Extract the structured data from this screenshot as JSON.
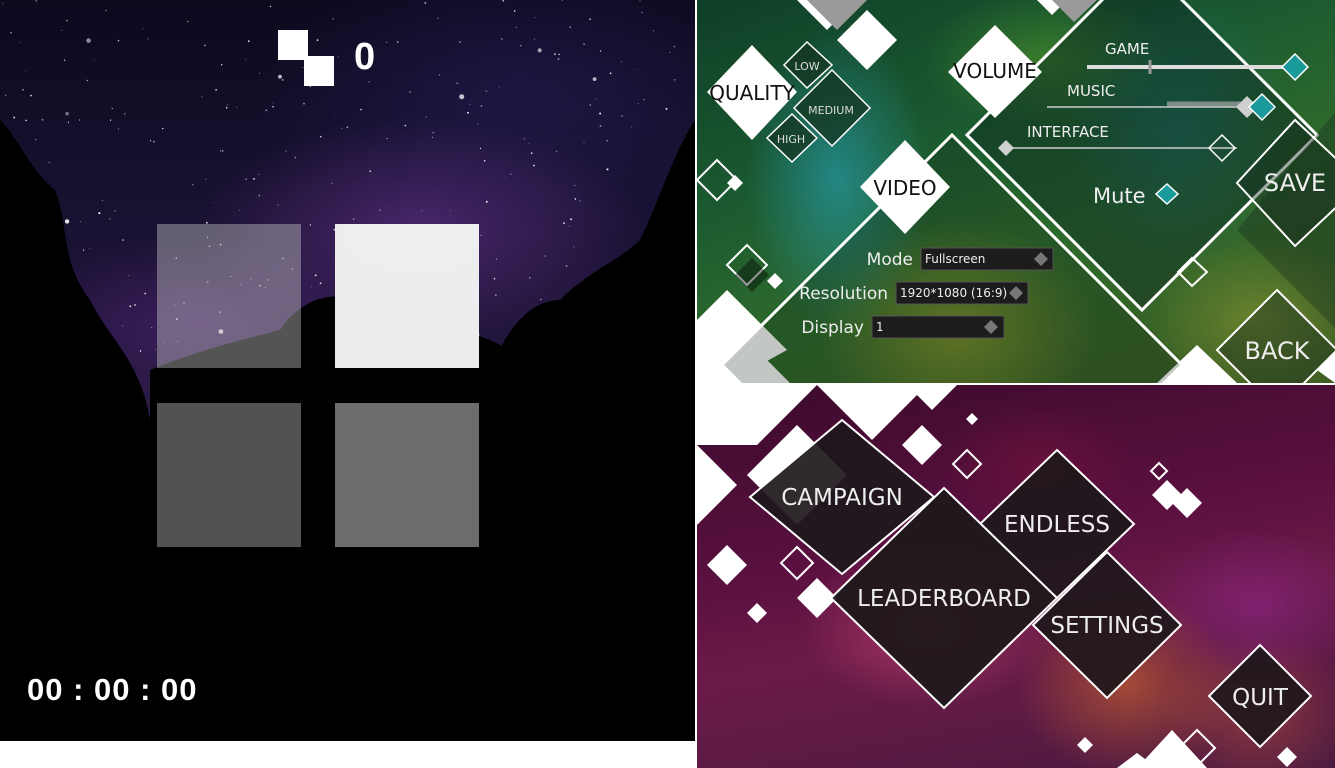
{
  "game": {
    "score": "0",
    "timer": "00 : 00 : 00",
    "tiles": [
      {
        "id": "tl",
        "state": "dim"
      },
      {
        "id": "tr",
        "state": "lit"
      },
      {
        "id": "bl",
        "state": "dim"
      },
      {
        "id": "br",
        "state": "dim"
      }
    ]
  },
  "settings": {
    "quality": {
      "label": "QUALITY",
      "options": [
        "LOW",
        "MEDIUM",
        "HIGH"
      ]
    },
    "volume": {
      "label": "VOLUME",
      "sliders": [
        {
          "label": "GAME",
          "value": 0.93
        },
        {
          "label": "MUSIC",
          "value": 0.92
        },
        {
          "label": "INTERFACE",
          "value": 0.0
        }
      ],
      "mute_label": "Mute"
    },
    "video": {
      "label": "VIDEO",
      "rows": [
        {
          "label": "Mode",
          "value": "Fullscreen"
        },
        {
          "label": "Resolution",
          "value": "1920*1080 (16:9)"
        },
        {
          "label": "Display",
          "value": "1"
        }
      ]
    },
    "save_label": "SAVE",
    "back_label": "BACK"
  },
  "main_menu": {
    "campaign": "CAMPAIGN",
    "endless": "ENDLESS",
    "leaderboard": "LEADERBOARD",
    "settings": "SETTINGS",
    "quit": "QUIT"
  },
  "colors": {
    "accent_teal": "#1a9a9a",
    "panel_dark": "#1e1a1c"
  }
}
